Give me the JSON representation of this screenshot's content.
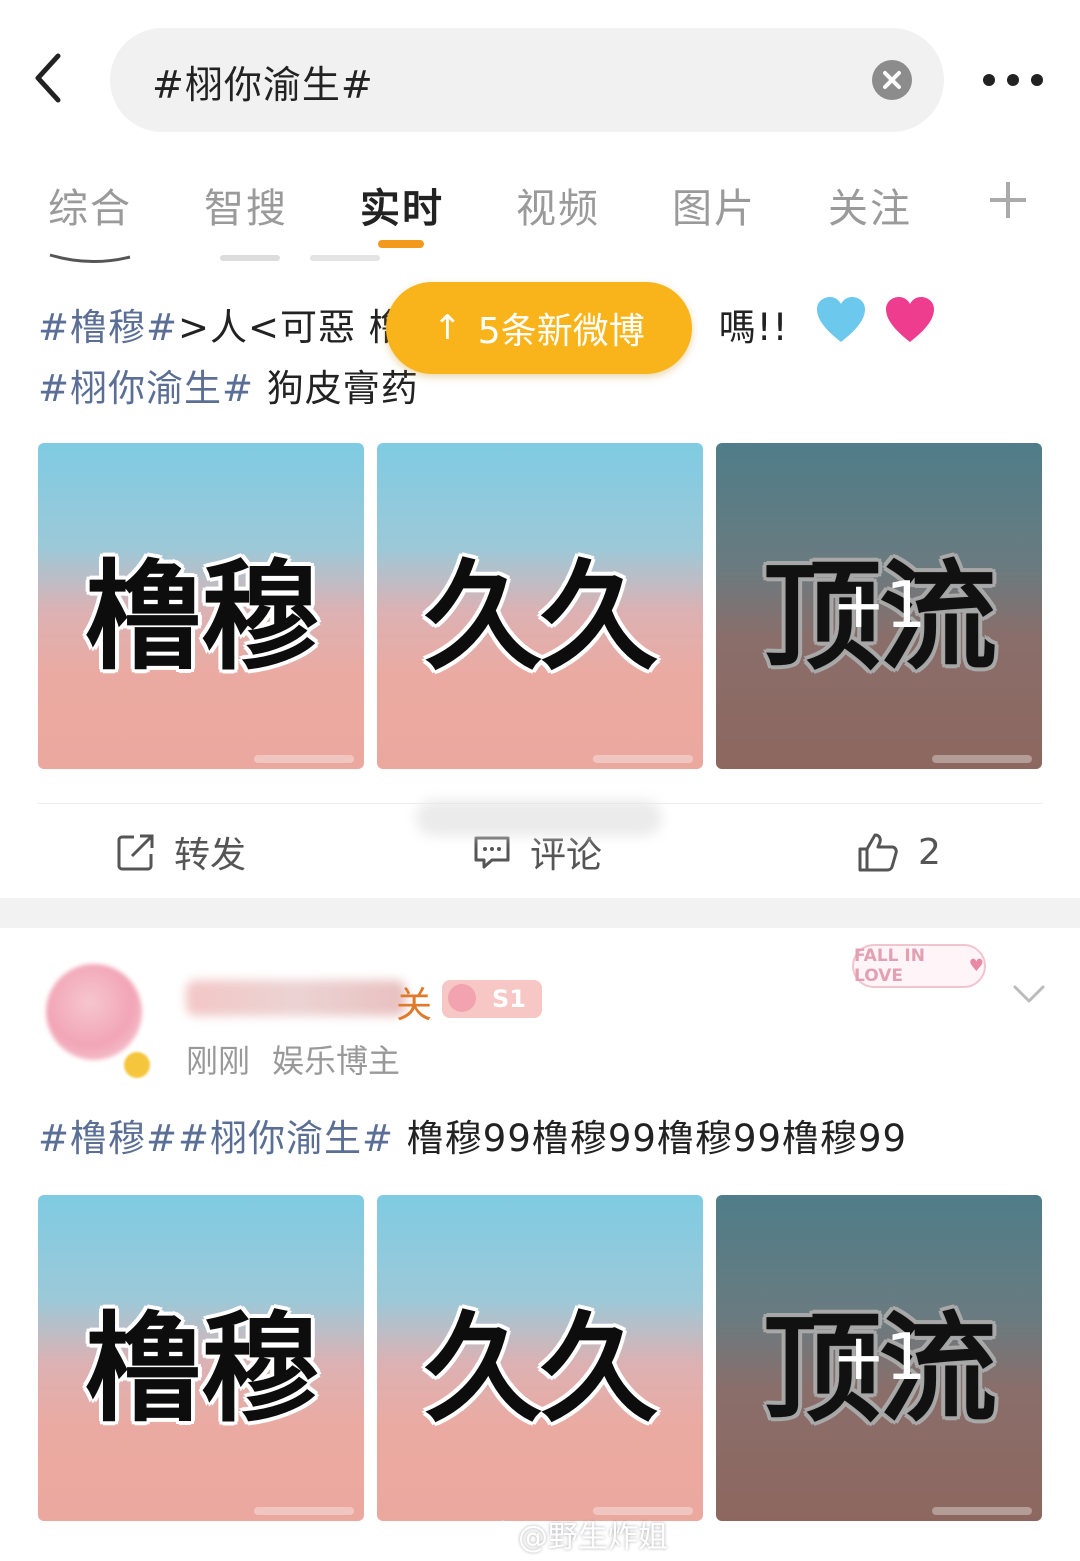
{
  "header": {
    "search_text": "#栩你渝生#"
  },
  "tabs": [
    {
      "label": "综合"
    },
    {
      "label": "智搜"
    },
    {
      "label": "实时",
      "active": true
    },
    {
      "label": "视频"
    },
    {
      "label": "图片"
    },
    {
      "label": "关注"
    }
  ],
  "new_posts_pill": {
    "arrow": "↑",
    "label": "5条新微博"
  },
  "post1": {
    "line1_tag": "#橹穆#",
    "line1_text": ">⼈<可惡 橹",
    "line1_tail": "嗎!!",
    "line2_tag": "#栩你渝生#",
    "line2_text": " 狗皮膏药",
    "images": [
      "橹穆",
      "久久",
      "顶流"
    ],
    "more_count": "+1",
    "actions": {
      "repost_label": "转发",
      "comment_label": "评论",
      "like_count": "2"
    }
  },
  "post2": {
    "name_tail": "关",
    "level_badge": "S1",
    "time": "刚刚",
    "meta": "娱乐博主",
    "sticker": "FALL IN LOVE",
    "line1_tag": "#橹穆##栩你渝生#",
    "line1_text": " 橹穆99橹穆99橹穆99橹穆99",
    "images": [
      "橹穆",
      "久久",
      "顶流"
    ],
    "more_count": "+1"
  },
  "watermark": "@野生炸姐",
  "colors": {
    "accent_orange": "#f39a1d",
    "pill": "#f8b41a",
    "topic_link": "#5b6f96"
  }
}
